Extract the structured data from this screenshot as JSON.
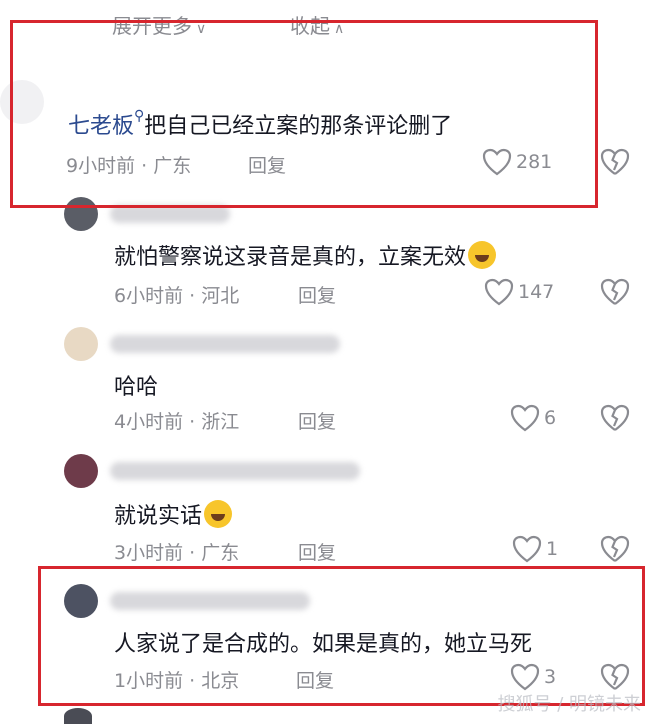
{
  "top": {
    "expand_label": "展开更多",
    "collapse_label": "收起"
  },
  "comments": [
    {
      "name": "七老板",
      "text": "把自己已经立案的那条评论删了",
      "time": "9小时前",
      "location": "广东",
      "reply": "回复",
      "likes": "281"
    },
    {
      "text": "就怕警察说这录音是真的，立案无效",
      "time": "6小时前",
      "location": "河北",
      "reply": "回复",
      "likes": "147"
    },
    {
      "text": "哈哈",
      "time": "4小时前",
      "location": "浙江",
      "reply": "回复",
      "likes": "6"
    },
    {
      "text": "就说实话",
      "time": "3小时前",
      "location": "广东",
      "reply": "回复",
      "likes": "1"
    },
    {
      "text": "人家说了是合成的。如果是真的，她立马死",
      "time": "1小时前",
      "location": "北京",
      "reply": "回复",
      "likes": "3"
    }
  ],
  "colors": {
    "highlight": "#d7262e",
    "username": "#2b4a8f",
    "meta": "#8a8b91"
  },
  "icons": {
    "like": "heart-outline-icon",
    "dislike": "broken-heart-icon"
  },
  "watermark": "搜狐号 / 明镜未来"
}
